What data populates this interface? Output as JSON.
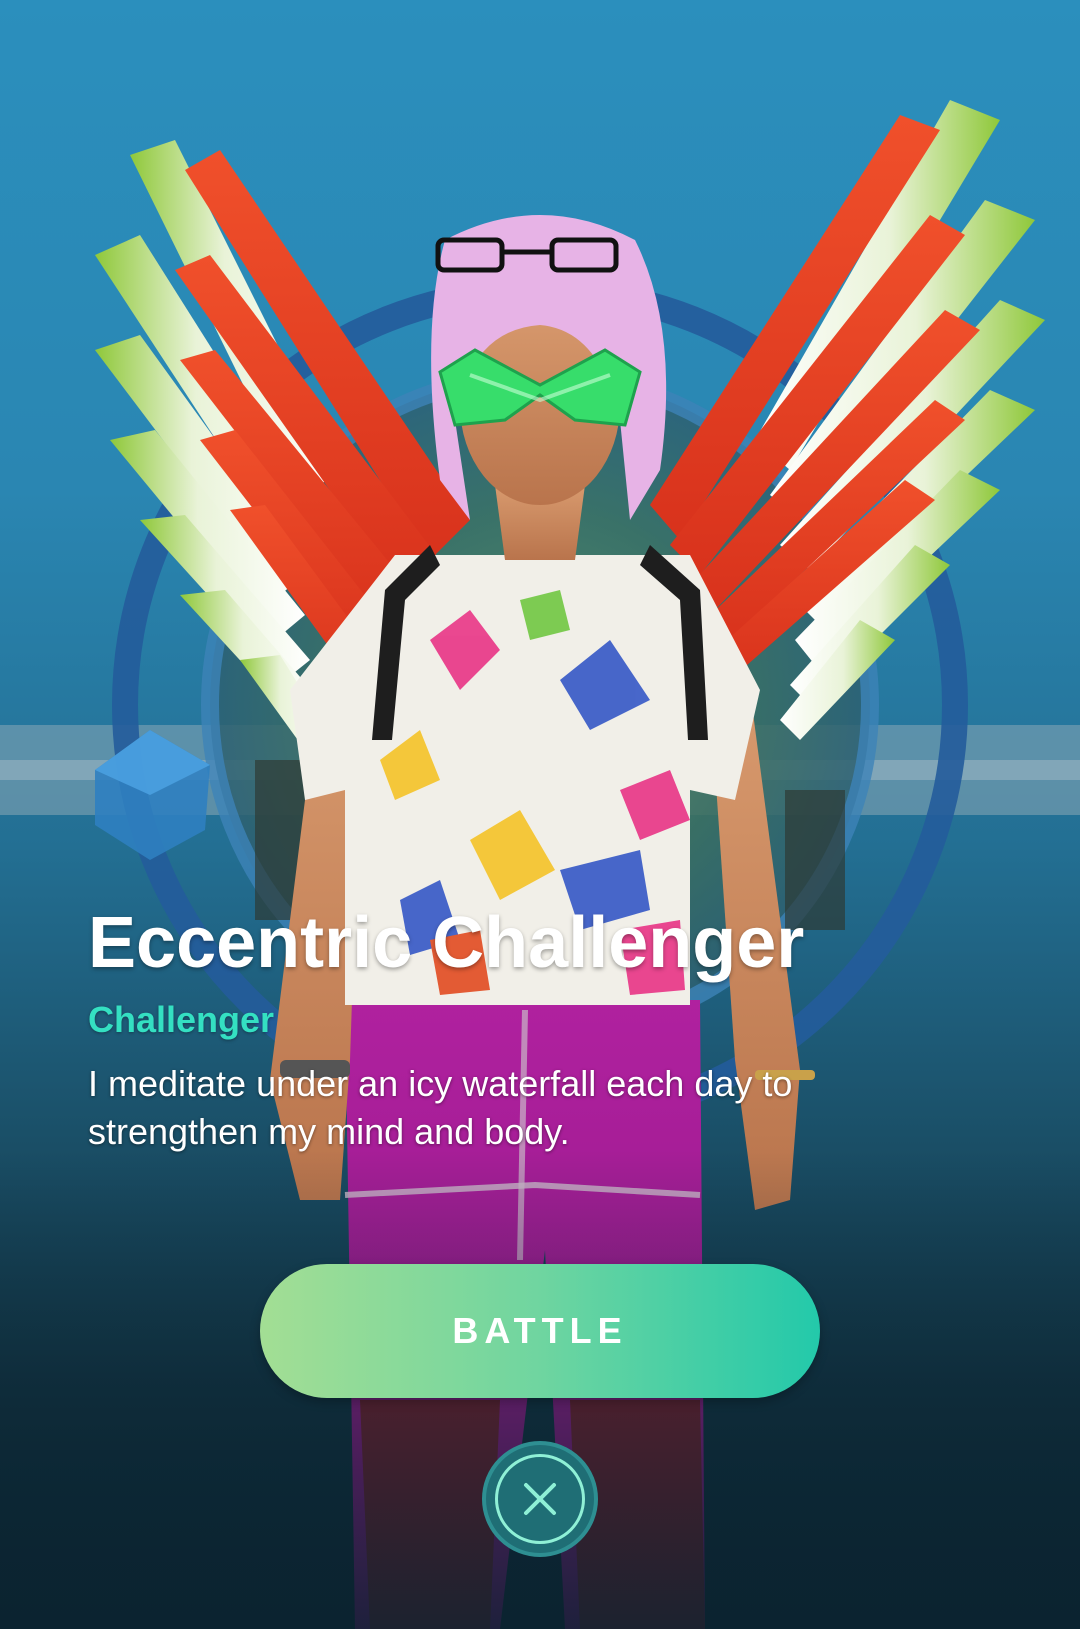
{
  "trainer": {
    "name": "Eccentric Challenger",
    "class": "Challenger",
    "quote": "I meditate under an icy waterfall each day to strengthen my mind and body."
  },
  "actions": {
    "battle_label": "BATTLE"
  },
  "icons": {
    "close": "close-icon"
  },
  "colors": {
    "class_accent": "#34e0c2",
    "battle_gradient_start": "#a3de94",
    "battle_gradient_end": "#23c9aa",
    "close_background": "#1f6e75"
  }
}
